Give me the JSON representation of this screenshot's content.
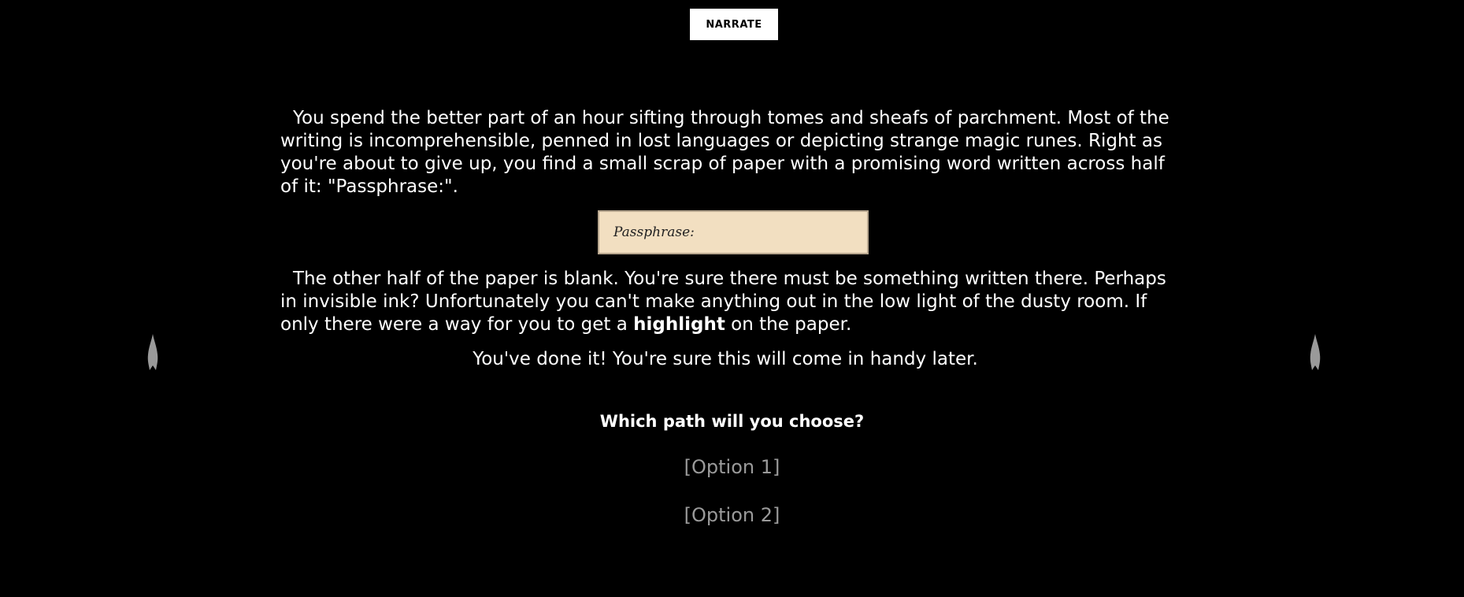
{
  "toolbar": {
    "narrate_label": "NARRATE"
  },
  "story": {
    "paragraph1": "You spend the better part of an hour sifting through tomes and sheafs of parchment. Most of the writing is incomprehensible, penned in lost languages or depicting strange magic runes. Right as you're about to give up, you find a small scrap of paper with a promising word written across half of it: \"Passphrase:\".",
    "scrap_text": "Passphrase:",
    "paragraph2_before": "The other half of the paper is blank. You're sure there must be something written there. Perhaps in invisible ink? Unfortunately you can't make anything out in the low light of the dusty room. If only there were a way for you to get a ",
    "paragraph2_highlight": "highlight",
    "paragraph2_after": " on the paper.",
    "success_line": "You've done it! You're sure this will come in handy later."
  },
  "choices": {
    "question": "Which path will you choose?",
    "options": [
      {
        "label": "[Option 1]"
      },
      {
        "label": "[Option 2]"
      }
    ]
  },
  "decor": {
    "left_icon": "torch-flame-icon",
    "right_icon": "torch-flame-icon",
    "flame_color": "#9a9a9a",
    "scrap_color": "#f2dfc1"
  }
}
